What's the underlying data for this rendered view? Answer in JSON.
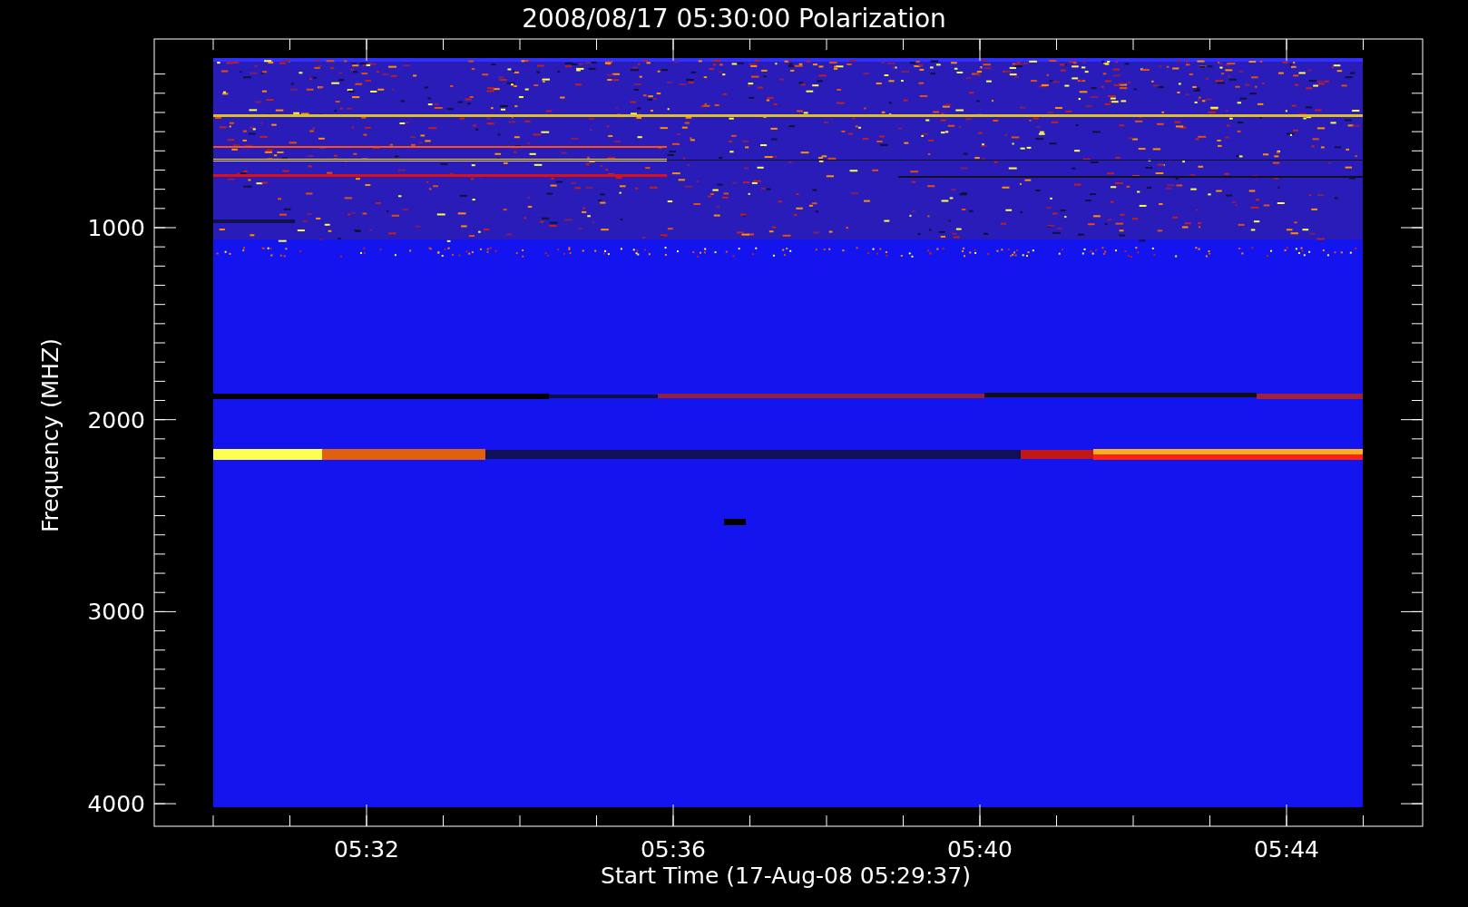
{
  "plot": {
    "title": "2008/08/17 05:30:00 Polarization",
    "ylabel": "Frequency (MHZ)",
    "xlabel": "Start Time (17-Aug-08 05:29:37)",
    "yticks": [
      "1000",
      "2000",
      "3000",
      "4000"
    ],
    "xticks": [
      "05:32",
      "05:36",
      "05:40",
      "05:44"
    ]
  }
}
